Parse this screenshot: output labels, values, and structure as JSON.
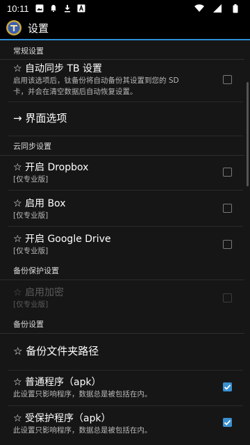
{
  "status": {
    "time": "10:11"
  },
  "appbar": {
    "title": "设置"
  },
  "sections": {
    "general": "常规设置",
    "cloud": "云同步设置",
    "backup_protection": "备份保护设置",
    "backup": "备份设置"
  },
  "items": {
    "auto_sync": {
      "title": "☆ 自动同步 TB 设置",
      "summary_line1": "启用该选项后，钛备份将自动备份其设置到您的 SD",
      "summary_line2": "卡，并会在清空数据后自动恢复设置。",
      "checked": false
    },
    "ui_options": {
      "title": "→ 界面选项"
    },
    "dropbox": {
      "title": "☆ 开启 Dropbox",
      "summary": "[仅专业版]",
      "checked": false
    },
    "box": {
      "title": "☆ 启用 Box",
      "summary": "[仅专业版]",
      "checked": false
    },
    "gdrive": {
      "title": "☆ 开启 Google Drive",
      "summary": "[仅专业版]",
      "checked": false
    },
    "encryption": {
      "title": "☆ 启用加密",
      "summary": "[仅专业版]",
      "checked": false,
      "enabled": false
    },
    "backup_path": {
      "title": "☆ 备份文件夹路径"
    },
    "normal_apps": {
      "title": "☆ 普通程序（apk）",
      "summary": "此设置只影响程序，数据总是被包括在内。",
      "checked": true
    },
    "protected_apps": {
      "title": "☆ 受保护程序（apk）",
      "summary": "此设置只影响程序，数据总是被包括在内。",
      "checked": true
    }
  },
  "colors": {
    "accent": "#2e8fd6",
    "checkbox_checked": "#3a8fd0"
  }
}
